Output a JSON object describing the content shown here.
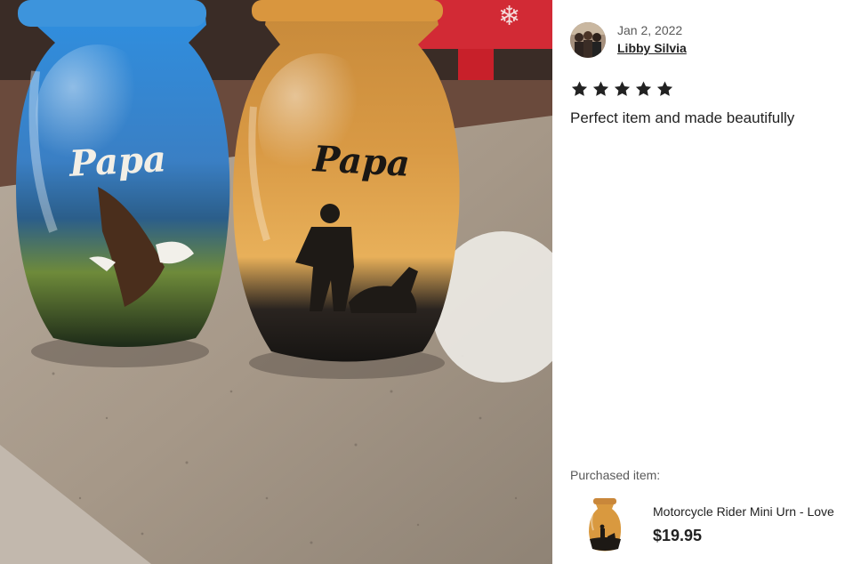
{
  "photo": {
    "left_urn_label": "Papa",
    "right_urn_label": "Papa"
  },
  "review": {
    "date": "Jan 2, 2022",
    "reviewer": "Libby Silvia",
    "rating": 5,
    "rating_max": 5,
    "text": "Perfect item and made beautifully"
  },
  "purchased": {
    "label": "Purchased item:",
    "item_title": "Motorcycle Rider Mini Urn - Love",
    "price": "$19.95"
  },
  "colors": {
    "star": "#222222",
    "text": "#222222",
    "muted": "#595959"
  },
  "icons": {
    "star": "star-icon",
    "avatar": "avatar"
  }
}
